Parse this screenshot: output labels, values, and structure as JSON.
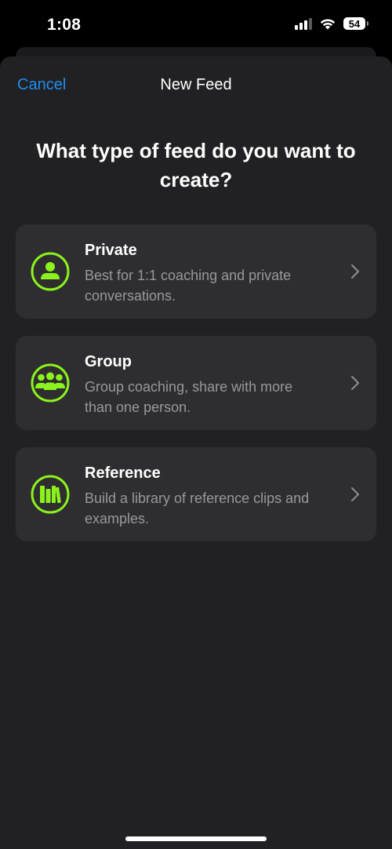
{
  "status_bar": {
    "time": "1:08",
    "battery": "54"
  },
  "nav": {
    "cancel_label": "Cancel",
    "title": "New Feed"
  },
  "prompt": "What type of feed do you want to create?",
  "options": [
    {
      "title": "Private",
      "description": "Best for 1:1 coaching and private conversations.",
      "icon": "person-circle-icon"
    },
    {
      "title": "Group",
      "description": "Group coaching, share with more than one person.",
      "icon": "group-circle-icon"
    },
    {
      "title": "Reference",
      "description": "Build a library of reference clips and examples.",
      "icon": "books-circle-icon"
    }
  ],
  "colors": {
    "accent_green": "#8cf21c",
    "link_blue": "#1e8ef0",
    "sheet_bg": "#212123",
    "card_bg": "#2e2e30"
  }
}
